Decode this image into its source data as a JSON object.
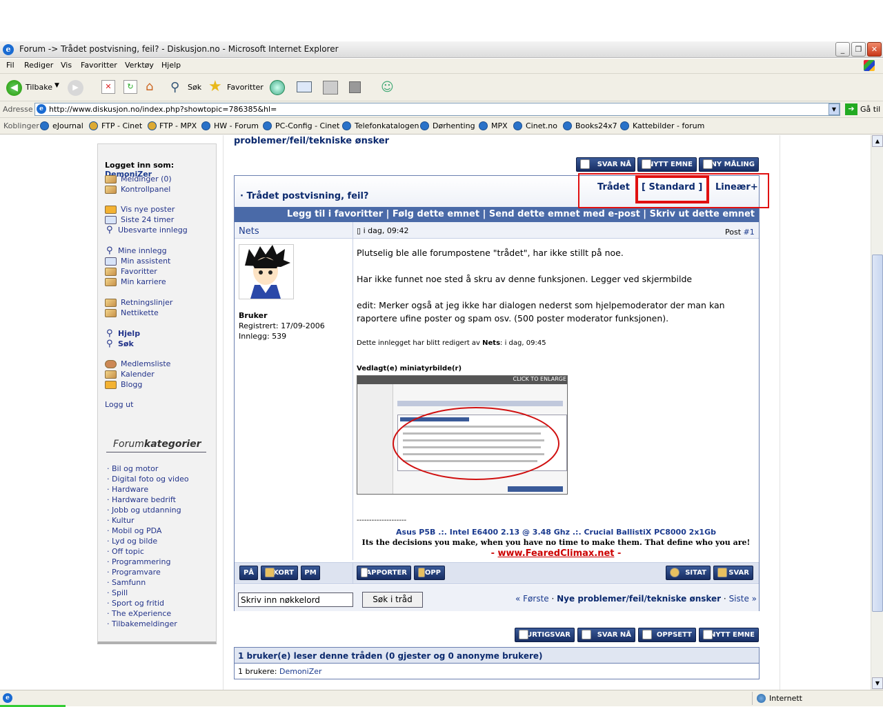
{
  "window": {
    "title": "Forum -> Trådet postvisning, feil? - Diskusjon.no - Microsoft Internet Explorer"
  },
  "menu": [
    "Fil",
    "Rediger",
    "Vis",
    "Favoritter",
    "Verktøy",
    "Hjelp"
  ],
  "toolbar": {
    "back": "Tilbake",
    "search": "Søk",
    "favorites": "Favoritter"
  },
  "address": {
    "label": "Adresse",
    "url": "http://www.diskusjon.no/index.php?showtopic=786385&hl=",
    "go": "Gå til"
  },
  "links": {
    "label": "Koblinger",
    "items": [
      "eJournal",
      "FTP - Cinet",
      "FTP - MPX",
      "HW - Forum",
      "PC-Config - Cinet",
      "Telefonkatalogen",
      "Dørhenting",
      "MPX",
      "Cinet.no",
      "Books24x7",
      "Kattebilder - forum"
    ]
  },
  "breadcrumb": "problemer/feil/tekniske ønsker",
  "sidebar": {
    "logged_in_label": "Logget inn som:",
    "username": "DemoniZer",
    "group1": [
      "Meldinger (0)",
      "Kontrollpanel"
    ],
    "group2": [
      "Vis nye poster",
      "Siste 24 timer",
      "Ubesvarte innlegg"
    ],
    "group3": [
      "Mine innlegg",
      "Min assistent",
      "Favoritter",
      "Min karriere"
    ],
    "group4": [
      "Retningslinjer",
      "Nettikette"
    ],
    "group5": [
      "Hjelp",
      "Søk"
    ],
    "group6": [
      "Medlemsliste",
      "Kalender",
      "Blogg"
    ],
    "logout": "Logg ut",
    "categories_title_a": "Forum",
    "categories_title_b": "kategorier",
    "categories": [
      "Bil og motor",
      "Digital foto og video",
      "Hardware",
      "Hardware bedrift",
      "Jobb og utdanning",
      "Kultur",
      "Mobil og PDA",
      "Lyd og bilde",
      "Off topic",
      "Programmering",
      "Programvare",
      "Samfunn",
      "Spill",
      "Sport og fritid",
      "The eXperience",
      "Tilbakemeldinger"
    ]
  },
  "top_buttons": [
    "SVAR NÅ",
    "NYTT EMNE",
    "NY MÅLING"
  ],
  "topic": {
    "title": "Trådet postvisning, feil?",
    "view_modes": [
      "Trådet",
      "[ Standard ]",
      "Lineær+"
    ],
    "actions": "Legg til i favoritter | Følg dette emnet | Send dette emnet med e-post | Skriv ut dette emnet"
  },
  "post": {
    "author": "Nets",
    "date": "i dag, 09:42",
    "post_label": "Post",
    "post_num": "#1",
    "group": "Bruker",
    "registered": "Registrert: 17/09-2006",
    "posts": "Innlegg: 539",
    "p1": "Plutselig ble alle forumpostene \"trådet\", har ikke stillt på noe.",
    "p2": "Har ikke funnet noe sted å skru av denne funksjonen. Legger ved skjermbilde",
    "p3": "edit: Merker også at jeg ikke har dialogen nederst som hjelpemoderator der man kan raportere ufine poster og spam osv. (500 poster moderator funksjonen).",
    "edited_prefix": "Dette innlegget har blitt redigert av",
    "edited_by": "Nets",
    "edited_suffix": ": i dag, 09:45",
    "attachment_label": "Vedlagt(e) miniatyrbilde(r)",
    "thumb_enlarge": "CLICK TO ENLARGE",
    "sig_line": "--------------------",
    "sig1": "Asus P5B .:. Intel E6400 2.13 @ 3.48 Ghz .:. Crucial BallistiX PC8000 2x1Gb",
    "sig2": "Its the decisions you make, when you have no time to make them. That define who you are!",
    "sig3_link": "www.FearedClimax.net"
  },
  "post_buttons": {
    "left": [
      "PÅ",
      "KORT",
      "PM"
    ],
    "mid": [
      "RAPPORTER",
      "OPP"
    ],
    "right": [
      "SITAT",
      "SVAR"
    ]
  },
  "search": {
    "placeholder": "Skriv inn nøkkelord",
    "button": "Søk i tråd"
  },
  "pager": {
    "first": "« Første",
    "next": "Nye problemer/feil/tekniske ønsker",
    "last": "Siste »"
  },
  "bottom_buttons": [
    "HURTIGSVAR",
    "SVAR NÅ",
    "OPPSETT",
    "NYTT EMNE"
  ],
  "readers": {
    "title": "1 bruker(e) leser denne tråden (0 gjester og 0 anonyme brukere)",
    "label": "1 brukere:",
    "user": "DemoniZer"
  },
  "status": {
    "zone": "Internett"
  }
}
